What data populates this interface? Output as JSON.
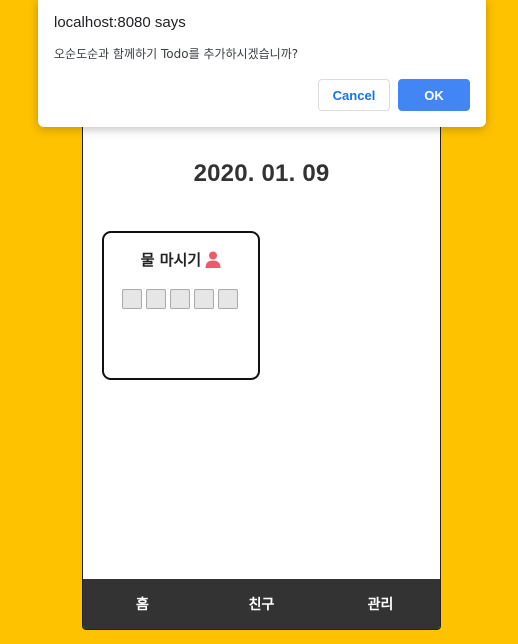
{
  "colors": {
    "background": "#FFC200",
    "tabbar": "#333333",
    "ok_button": "#4285F4",
    "cancel_text": "#1a73e8",
    "person_icon": "#F0596A"
  },
  "app": {
    "date": "2020. 01. 09",
    "todo": {
      "title": "물 마시기",
      "icon": "person-icon",
      "checkbox_count": 5
    },
    "tabbar": {
      "home": "홈",
      "friends": "친구",
      "manage": "관리"
    }
  },
  "dialog": {
    "title": "localhost:8080 says",
    "message": "오순도순과 함께하기 Todo를 추가하시겠습니까?",
    "cancel_label": "Cancel",
    "ok_label": "OK"
  }
}
